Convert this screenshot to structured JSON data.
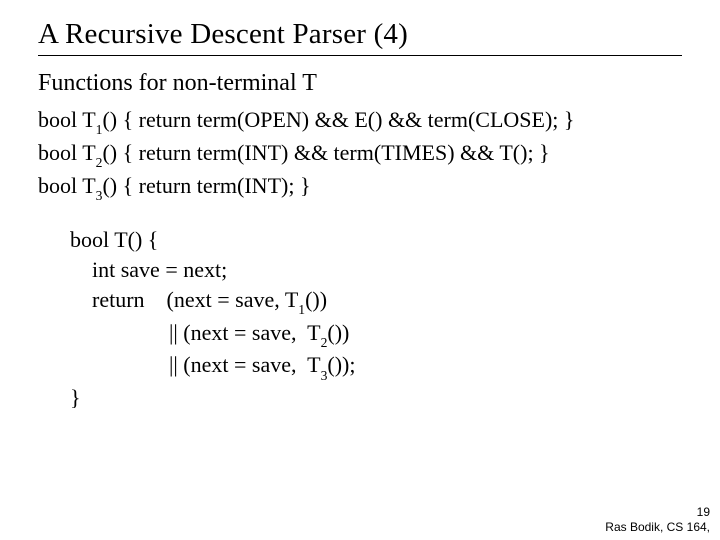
{
  "title": "A Recursive Descent Parser (4)",
  "subtitle": "Functions for non-terminal T",
  "defs": {
    "t1_a": "bool T",
    "t1_s": "1",
    "t1_b": "() { return term(OPEN) && E() && term(CLOSE); }",
    "t2_a": "bool T",
    "t2_s": "2",
    "t2_b": "() { return term(INT) && term(TIMES) && T(); }",
    "t3_a": "bool T",
    "t3_s": "3",
    "t3_b": "() { return term(INT); }"
  },
  "body": {
    "l1": "bool T() {",
    "l2": "    int save = next;",
    "l3a": "    return    (next = save, T",
    "l3s": "1",
    "l3b": "())",
    "l4a": "                  || (next = save,  T",
    "l4s": "2",
    "l4b": "())",
    "l5a": "                  || (next = save,  T",
    "l5s": "3",
    "l5b": "());",
    "l6": "}"
  },
  "footer": {
    "page": "19",
    "attr": "Ras Bodik, CS 164,"
  }
}
